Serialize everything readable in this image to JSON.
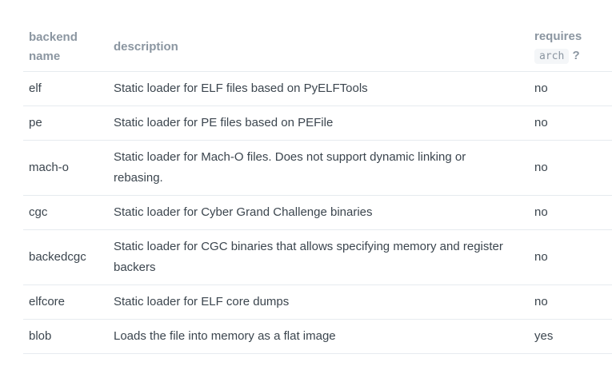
{
  "table": {
    "headers": {
      "name_line1": "backend",
      "name_line2": "name",
      "description": "description",
      "requires_line1": "requires",
      "requires_code": "arch",
      "requires_suffix": "?"
    },
    "rows": [
      {
        "name": "elf",
        "description": "Static loader for ELF files based on PyELFTools",
        "requires_arch": "no"
      },
      {
        "name": "pe",
        "description": "Static loader for PE files based on PEFile",
        "requires_arch": "no"
      },
      {
        "name": "mach-o",
        "description": "Static loader for Mach-O files. Does not support dynamic linking or rebasing.",
        "requires_arch": "no"
      },
      {
        "name": "cgc",
        "description": "Static loader for Cyber Grand Challenge binaries",
        "requires_arch": "no"
      },
      {
        "name": "backedcgc",
        "description": "Static loader for CGC binaries that allows specifying memory and register backers",
        "requires_arch": "no"
      },
      {
        "name": "elfcore",
        "description": "Static loader for ELF core dumps",
        "requires_arch": "no"
      },
      {
        "name": "blob",
        "description": "Loads the file into memory as a flat image",
        "requires_arch": "yes"
      }
    ]
  }
}
